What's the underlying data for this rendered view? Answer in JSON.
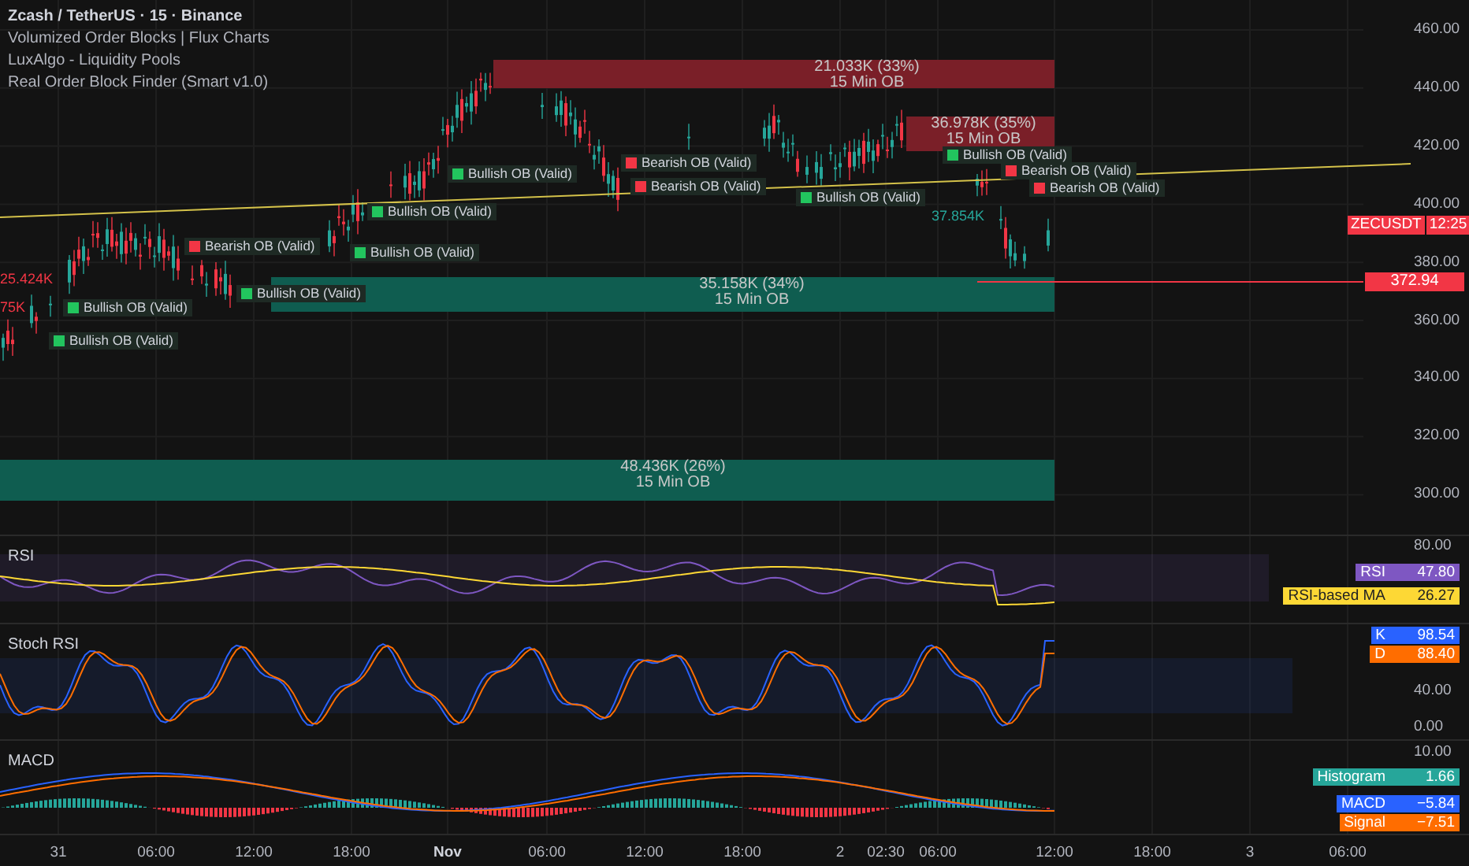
{
  "legend": {
    "symbol": "Zcash / TetherUS · 15 · Binance",
    "indicators": [
      "Volumized Order Blocks | Flux Charts",
      "LuxAlgo - Liquidity Pools",
      "Real Order Block Finder (Smart v1.0)"
    ]
  },
  "price_axis": [
    "460.00",
    "440.00",
    "420.00",
    "400.00",
    "380.00",
    "360.00",
    "340.00",
    "320.00",
    "300.00"
  ],
  "order_blocks": [
    {
      "kind": "bearish",
      "volume": "21.033K (33%)",
      "timeframe": "15 Min OB"
    },
    {
      "kind": "bearish",
      "volume": "36.978K (35%)",
      "timeframe": "15 Min OB"
    },
    {
      "kind": "bullish",
      "volume": "35.158K (34%)",
      "timeframe": "15 Min OB"
    },
    {
      "kind": "bullish",
      "volume": "48.436K (26%)",
      "timeframe": "15 Min OB"
    }
  ],
  "volume_labels": [
    {
      "kind": "bearish",
      "text": "25.424K"
    },
    {
      "kind": "bearish",
      "text": "75K"
    },
    {
      "kind": "bullish",
      "text": "37.854K"
    }
  ],
  "ob_labels": [
    {
      "kind": "bullish",
      "text": "Bullish OB (Valid)"
    },
    {
      "kind": "bullish",
      "text": "Bullish OB (Valid)"
    },
    {
      "kind": "bullish",
      "text": "Bullish OB (Valid)"
    },
    {
      "kind": "bearish",
      "text": "Bearish OB (Valid)"
    },
    {
      "kind": "bullish",
      "text": "Bullish OB (Valid)"
    },
    {
      "kind": "bullish",
      "text": "Bullish OB (Valid)"
    },
    {
      "kind": "bullish",
      "text": "Bullish OB (Valid)"
    },
    {
      "kind": "bearish",
      "text": "Bearish OB (Valid)"
    },
    {
      "kind": "bearish",
      "text": "Bearish OB (Valid)"
    },
    {
      "kind": "bullish",
      "text": "Bullish OB (Valid)"
    },
    {
      "kind": "bearish",
      "text": "Bearish OB (Valid)"
    },
    {
      "kind": "bearish",
      "text": "Bearish OB (Valid)"
    },
    {
      "kind": "bullish",
      "text": "Bullish OB (Valid)"
    }
  ],
  "symbol_tag": {
    "symbol": "ZECUSDT",
    "countdown": "12:25"
  },
  "last_price": "372.94",
  "panes": [
    {
      "title": "RSI",
      "axis": [
        "80.00"
      ],
      "tags": [
        {
          "name": "RSI",
          "value": "47.80",
          "color": "#7e57c2"
        },
        {
          "name": "RSI-based MA",
          "value": "26.27",
          "color": "#fdd835"
        }
      ]
    },
    {
      "title": "Stoch RSI",
      "axis": [
        "40.00",
        "0.00"
      ],
      "tags": [
        {
          "name": "K",
          "value": "98.54",
          "color": "#2962ff"
        },
        {
          "name": "D",
          "value": "88.40",
          "color": "#ff6d00"
        }
      ]
    },
    {
      "title": "MACD",
      "axis": [
        "10.00"
      ],
      "tags": [
        {
          "name": "Histogram",
          "value": "1.66",
          "color": "#26a69a"
        },
        {
          "name": "MACD",
          "value": "−5.84",
          "color": "#2962ff"
        },
        {
          "name": "Signal",
          "value": "−7.51",
          "color": "#ff6d00"
        }
      ]
    }
  ],
  "time_axis": [
    {
      "label": "31",
      "bold": false
    },
    {
      "label": "06:00",
      "bold": false
    },
    {
      "label": "12:00",
      "bold": false
    },
    {
      "label": "18:00",
      "bold": false
    },
    {
      "label": "Nov",
      "bold": true
    },
    {
      "label": "06:00",
      "bold": false
    },
    {
      "label": "12:00",
      "bold": false
    },
    {
      "label": "18:00",
      "bold": false
    },
    {
      "label": "2",
      "bold": false
    },
    {
      "label": "02:30",
      "bold": false
    },
    {
      "label": "06:00",
      "bold": false
    },
    {
      "label": "12:00",
      "bold": false
    },
    {
      "label": "18:00",
      "bold": false
    },
    {
      "label": "3",
      "bold": false
    },
    {
      "label": "06:00",
      "bold": false
    }
  ]
}
